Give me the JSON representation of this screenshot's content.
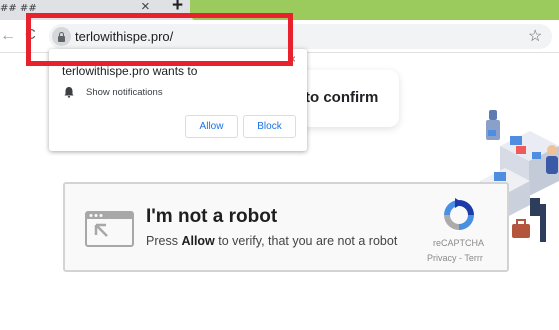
{
  "browser": {
    "tab_title": "## ##",
    "tab_close": "×",
    "new_tab": "+",
    "url": "terlowithispe.pro/",
    "back_icon": "←",
    "reload_icon": "C",
    "star_icon": "☆",
    "accent_color": "#9ccb5d",
    "highlight_color": "#e8212c"
  },
  "permission_popup": {
    "title": "terlowithispe.pro wants to",
    "close": "×",
    "permission": "Show notifications",
    "permission_icon": "bell-icon",
    "allow_label": "Allow",
    "block_label": "Block"
  },
  "page": {
    "confirm_text": "to confirm",
    "captcha": {
      "title": "I'm not a robot",
      "subtitle_prefix": "Press ",
      "subtitle_bold": "Allow",
      "subtitle_suffix": " to verify, that you are not a robot",
      "brand": "reCAPTCHA",
      "links": "Privacy - Terrr"
    }
  }
}
